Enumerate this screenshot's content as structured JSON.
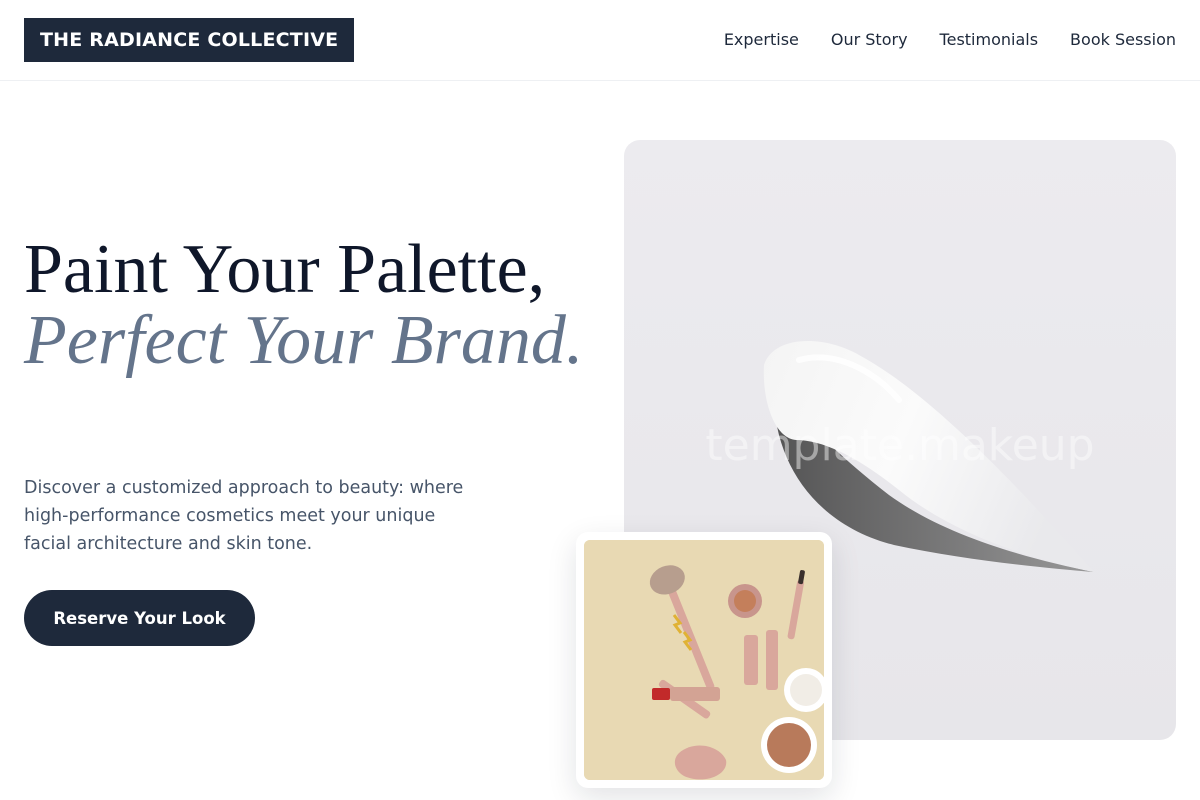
{
  "header": {
    "logo": "THE RADIANCE COLLECTIVE",
    "nav": [
      "Expertise",
      "Our Story",
      "Testimonials",
      "Book Session"
    ]
  },
  "hero": {
    "headline_line1": "Paint Your Palette,",
    "headline_line2": "Perfect Your Brand.",
    "description": "Discover a customized approach to beauty: where high-performance cosmetics meet your unique facial architecture and skin tone.",
    "cta_label": "Reserve Your Look",
    "image_watermark": "template.makeup"
  },
  "colors": {
    "primary": "#1e293b",
    "accent_text": "#64748b",
    "body_text": "#475569",
    "thumb_background": "#e8d9b3"
  }
}
